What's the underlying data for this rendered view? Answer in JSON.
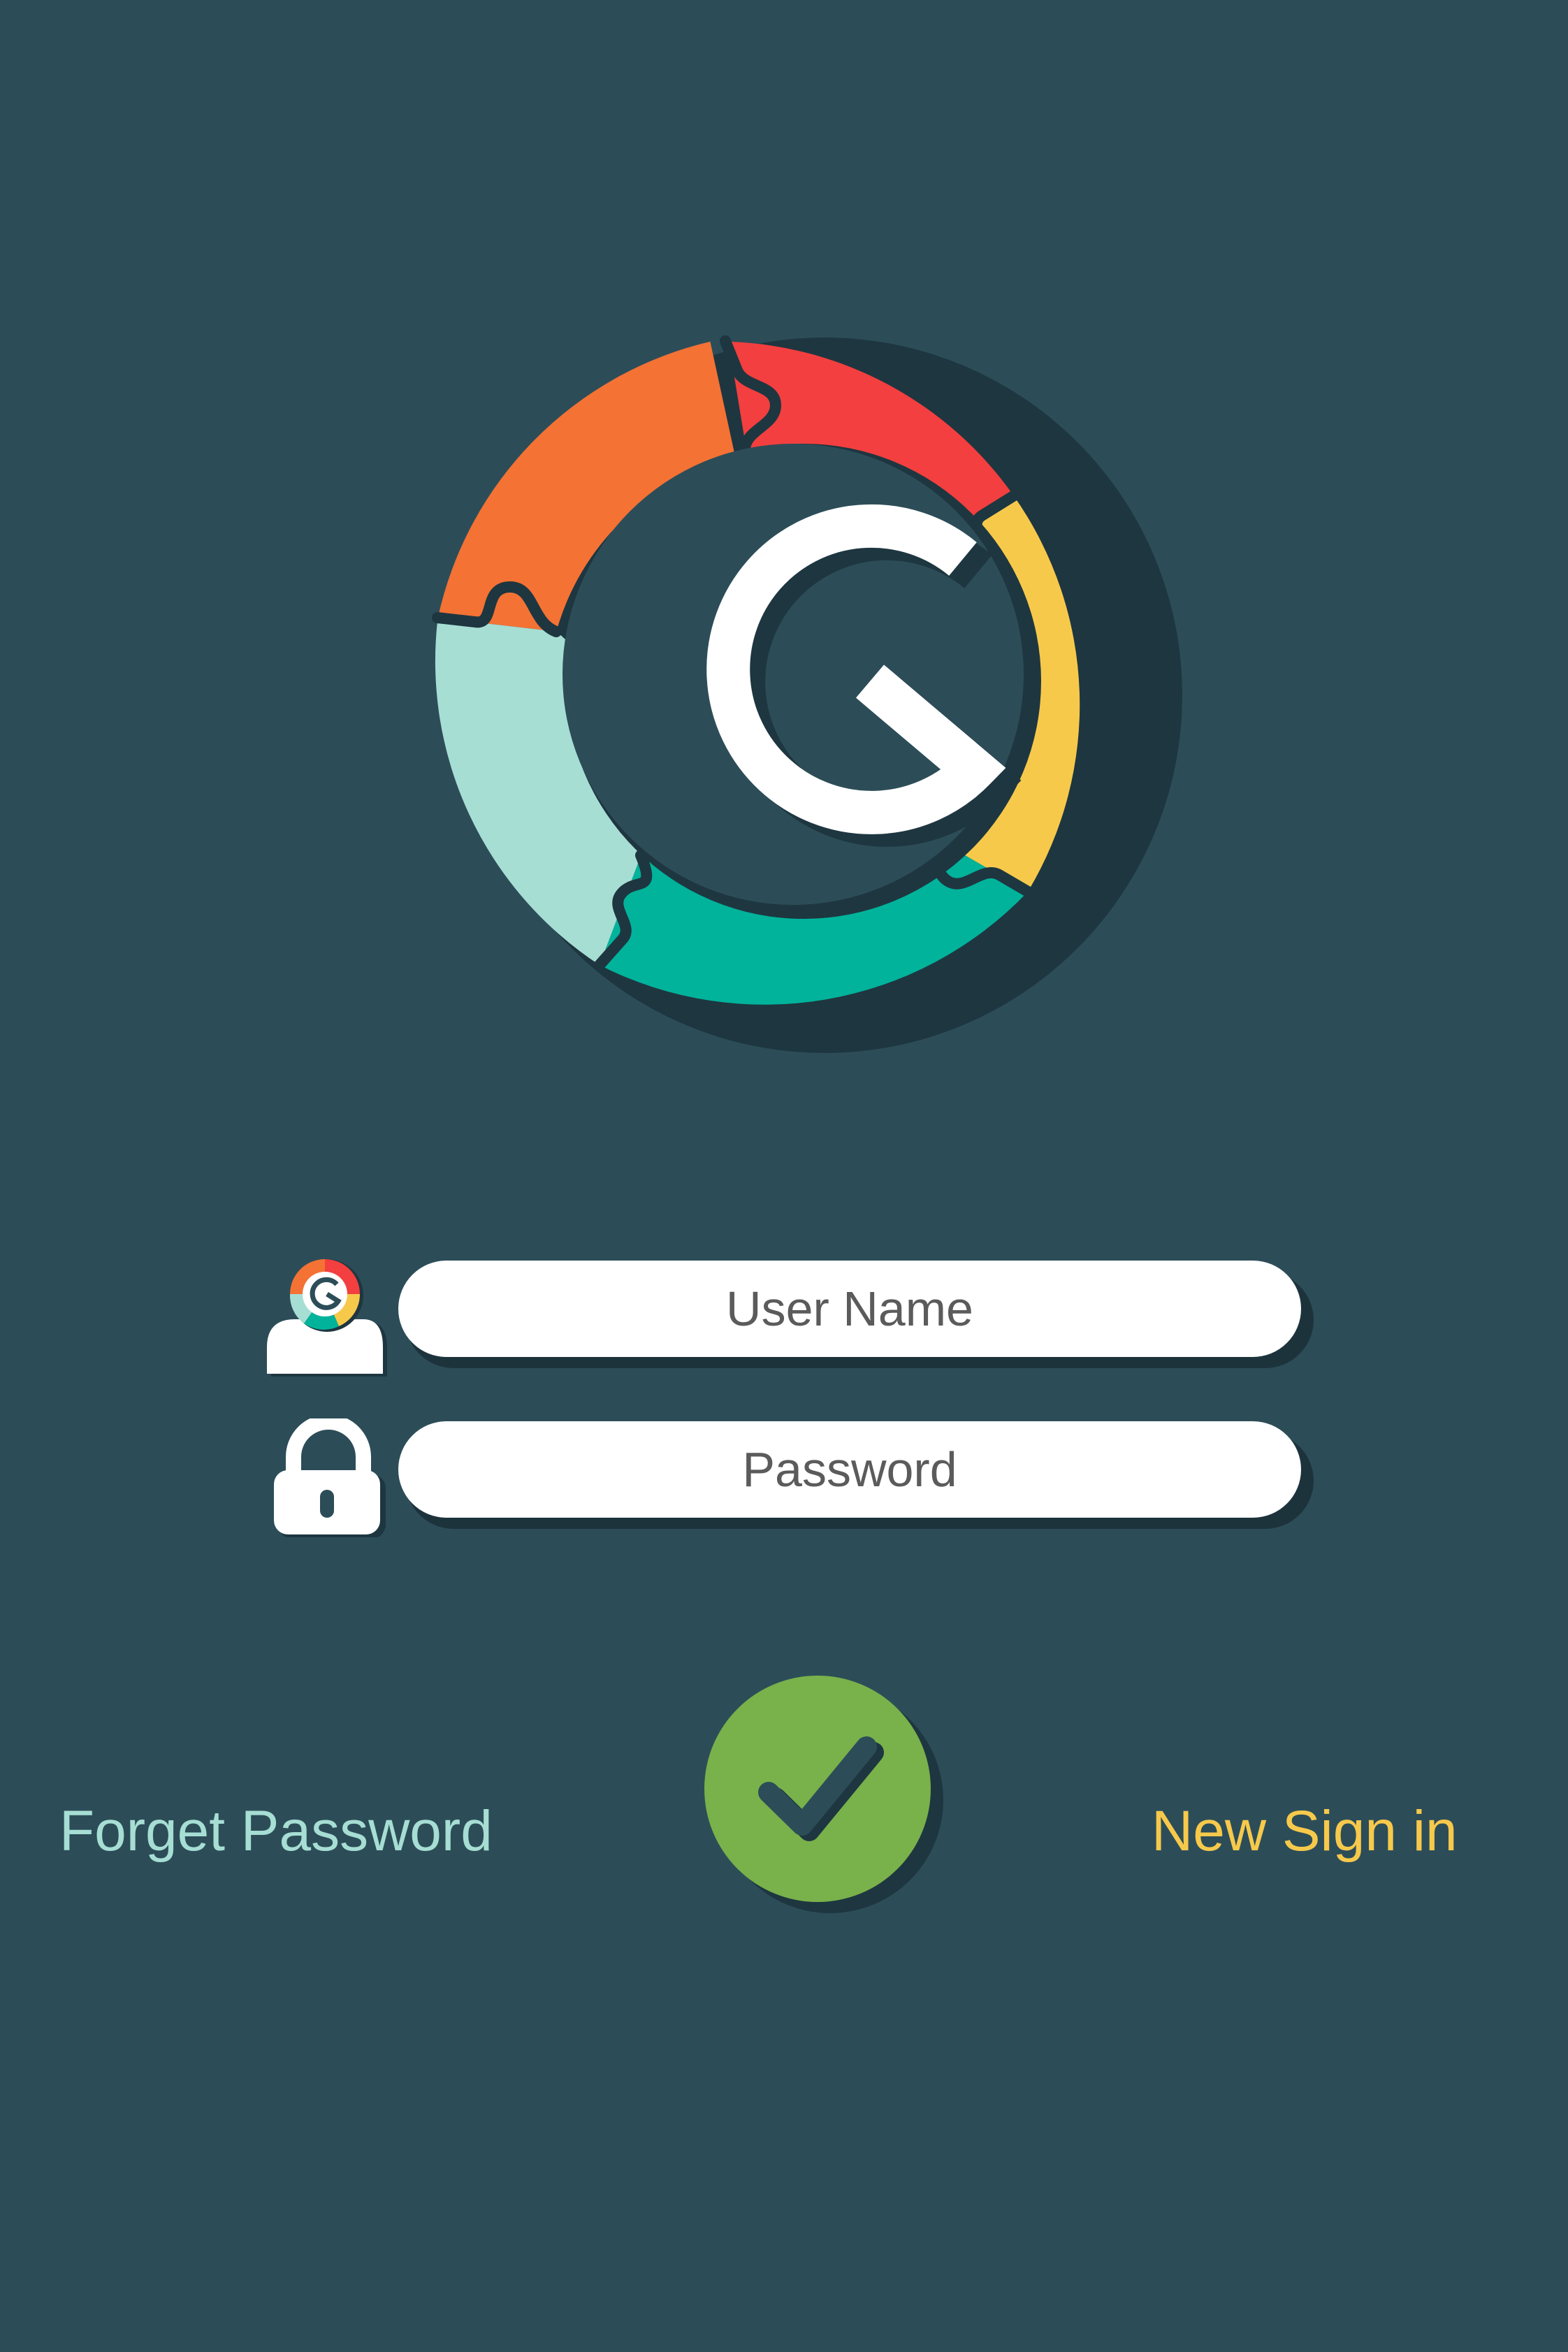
{
  "logo": {
    "letter": "G",
    "colors": {
      "orange": "#f47234",
      "red": "#f33f3f",
      "yellow": "#f7c94b",
      "teal": "#01b39b",
      "mint": "#a7ded4",
      "shadow": "#1e3640",
      "background": "#2c4d58",
      "letter": "#ffffff"
    }
  },
  "form": {
    "username": {
      "placeholder": "User Name",
      "value": "",
      "icon": "user-icon"
    },
    "password": {
      "placeholder": "Password",
      "value": "",
      "icon": "lock-icon"
    }
  },
  "actions": {
    "forget_password": "Forget Password",
    "new_sign_in": "New Sign in",
    "submit_icon": "checkmark-icon"
  },
  "colors": {
    "background": "#2c4d58",
    "field": "#ffffff",
    "field_text": "#5b5b5b",
    "forget_link": "#a7ded4",
    "new_sign_in_link": "#f7c94b",
    "submit": "#79b14b"
  }
}
